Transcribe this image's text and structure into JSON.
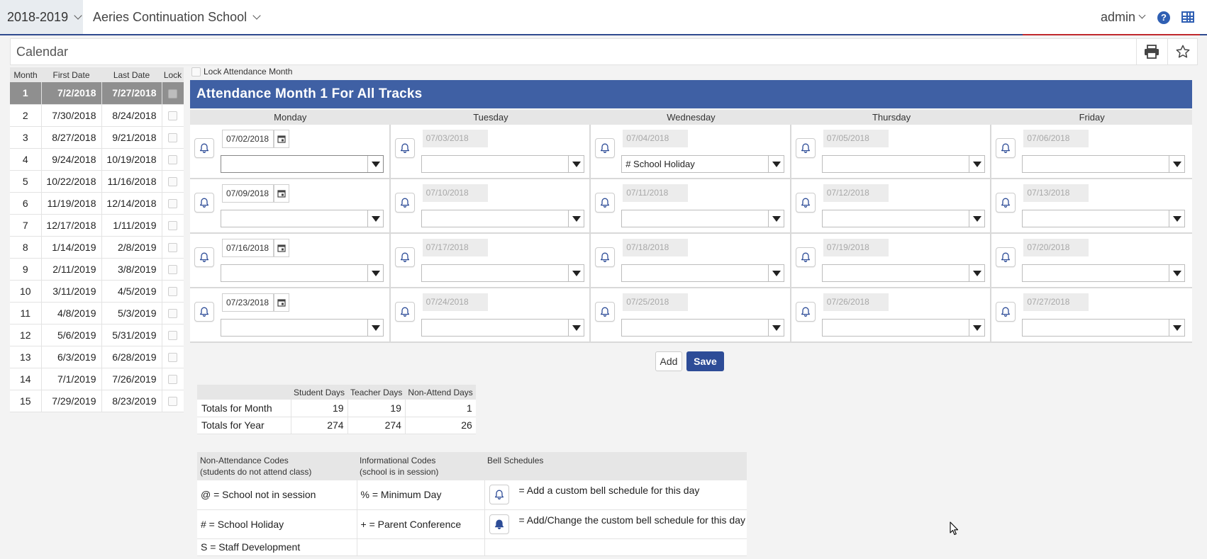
{
  "header": {
    "year": "2018-2019",
    "school": "Aeries Continuation School",
    "user": "admin",
    "help_icon": "?",
    "apps_icon": "grid-icon"
  },
  "page": {
    "title": "Calendar",
    "print_icon": "printer-icon",
    "favorite_icon": "star-icon"
  },
  "months": {
    "headers": [
      "Month",
      "First Date",
      "Last Date",
      "Lock"
    ],
    "rows": [
      {
        "month": "1",
        "first": "7/2/2018",
        "last": "7/27/2018",
        "selected": true
      },
      {
        "month": "2",
        "first": "7/30/2018",
        "last": "8/24/2018"
      },
      {
        "month": "3",
        "first": "8/27/2018",
        "last": "9/21/2018"
      },
      {
        "month": "4",
        "first": "9/24/2018",
        "last": "10/19/2018"
      },
      {
        "month": "5",
        "first": "10/22/2018",
        "last": "11/16/2018"
      },
      {
        "month": "6",
        "first": "11/19/2018",
        "last": "12/14/2018"
      },
      {
        "month": "7",
        "first": "12/17/2018",
        "last": "1/11/2019"
      },
      {
        "month": "8",
        "first": "1/14/2019",
        "last": "2/8/2019"
      },
      {
        "month": "9",
        "first": "2/11/2019",
        "last": "3/8/2019"
      },
      {
        "month": "10",
        "first": "3/11/2019",
        "last": "4/5/2019"
      },
      {
        "month": "11",
        "first": "4/8/2019",
        "last": "5/3/2019"
      },
      {
        "month": "12",
        "first": "5/6/2019",
        "last": "5/31/2019"
      },
      {
        "month": "13",
        "first": "6/3/2019",
        "last": "6/28/2019"
      },
      {
        "month": "14",
        "first": "7/1/2019",
        "last": "7/26/2019"
      },
      {
        "month": "15",
        "first": "7/29/2019",
        "last": "8/23/2019"
      }
    ]
  },
  "lock_attendance_label": "Lock Attendance Month",
  "attendance": {
    "title": "Attendance Month 1 For All Tracks",
    "days": [
      "Monday",
      "Tuesday",
      "Wednesday",
      "Thursday",
      "Friday"
    ],
    "weeks": [
      [
        {
          "date": "07/02/2018",
          "code": "",
          "editable": true
        },
        {
          "date": "07/03/2018",
          "code": ""
        },
        {
          "date": "07/04/2018",
          "code": "#  School Holiday"
        },
        {
          "date": "07/05/2018",
          "code": ""
        },
        {
          "date": "07/06/2018",
          "code": ""
        }
      ],
      [
        {
          "date": "07/09/2018",
          "code": "",
          "editable": true
        },
        {
          "date": "07/10/2018",
          "code": ""
        },
        {
          "date": "07/11/2018",
          "code": ""
        },
        {
          "date": "07/12/2018",
          "code": ""
        },
        {
          "date": "07/13/2018",
          "code": ""
        }
      ],
      [
        {
          "date": "07/16/2018",
          "code": "",
          "editable": true
        },
        {
          "date": "07/17/2018",
          "code": ""
        },
        {
          "date": "07/18/2018",
          "code": ""
        },
        {
          "date": "07/19/2018",
          "code": ""
        },
        {
          "date": "07/20/2018",
          "code": ""
        }
      ],
      [
        {
          "date": "07/23/2018",
          "code": "",
          "editable": true
        },
        {
          "date": "07/24/2018",
          "code": ""
        },
        {
          "date": "07/25/2018",
          "code": ""
        },
        {
          "date": "07/26/2018",
          "code": ""
        },
        {
          "date": "07/27/2018",
          "code": ""
        }
      ]
    ],
    "add_label": "Add",
    "save_label": "Save"
  },
  "totals": {
    "headers": [
      "Student Days",
      "Teacher Days",
      "Non-Attend Days"
    ],
    "rows": [
      {
        "label": "Totals for Month",
        "student": "19",
        "teacher": "19",
        "nonattend": "1"
      },
      {
        "label": "Totals for Year",
        "student": "274",
        "teacher": "274",
        "nonattend": "26"
      }
    ]
  },
  "legend": {
    "col1_header_1": "Non-Attendance Codes",
    "col1_header_2": "(students do not attend class)",
    "col2_header_1": "Informational Codes",
    "col2_header_2": "(school is in session)",
    "col3_header": "Bell Schedules",
    "rows": [
      {
        "nonattend": "@ = School not in session",
        "info": "% = Minimum Day",
        "bell": "= Add a custom bell schedule for this day",
        "bell_filled": false
      },
      {
        "nonattend": "# = School Holiday",
        "info": "+ = Parent Conference",
        "bell": "= Add/Change the custom bell schedule for this day",
        "bell_filled": true
      },
      {
        "nonattend": "S = Staff Development",
        "info": "",
        "bell": ""
      }
    ]
  },
  "colors": {
    "accent": "#3f60a4",
    "save": "#2d4c97",
    "selected_row": "#8f8f8f"
  }
}
